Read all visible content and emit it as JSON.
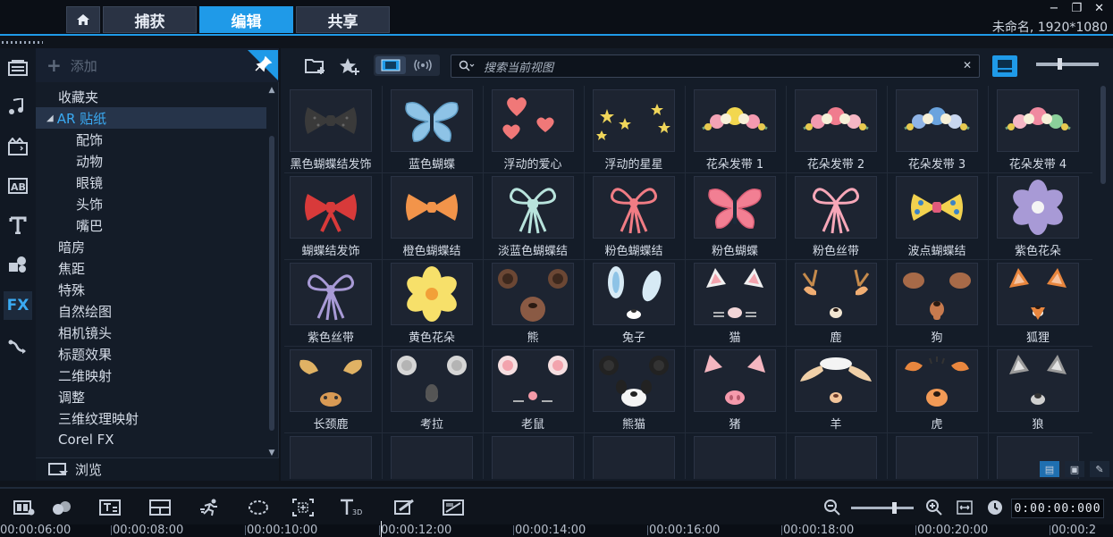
{
  "window": {
    "title": "未命名, 1920*1080",
    "controls": [
      "−",
      "❐",
      "✕"
    ]
  },
  "tabs": [
    {
      "label": "捕获",
      "active": false
    },
    {
      "label": "编辑",
      "active": true
    },
    {
      "label": "共享",
      "active": false
    }
  ],
  "icon_bar": [
    "media-icon",
    "audio-icon",
    "instant-project-icon",
    "transition-icon",
    "title-icon",
    "graphics-icon",
    "filter-fx-icon",
    "path-icon"
  ],
  "icon_bar_fx_label": "FX",
  "icon_bar_transition_label": "AB",
  "category_panel": {
    "add_label": "添加",
    "items": [
      {
        "label": "收藏夹",
        "level": 0
      },
      {
        "label": "AR 贴纸",
        "level": 0,
        "selected": true,
        "expanded": true,
        "arrow": "◢"
      },
      {
        "label": "配饰",
        "level": 1
      },
      {
        "label": "动物",
        "level": 1
      },
      {
        "label": "眼镜",
        "level": 1
      },
      {
        "label": "头饰",
        "level": 1
      },
      {
        "label": "嘴巴",
        "level": 1
      },
      {
        "label": "暗房",
        "level": 0
      },
      {
        "label": "焦距",
        "level": 0
      },
      {
        "label": "特殊",
        "level": 0
      },
      {
        "label": "自然绘图",
        "level": 0
      },
      {
        "label": "相机镜头",
        "level": 0
      },
      {
        "label": "标题效果",
        "level": 0
      },
      {
        "label": "二维映射",
        "level": 0
      },
      {
        "label": "调整",
        "level": 0
      },
      {
        "label": "三维纹理映射",
        "level": 0
      },
      {
        "label": "Corel FX",
        "level": 0
      }
    ],
    "browse_label": "浏览"
  },
  "library": {
    "search_placeholder": "搜索当前视图",
    "items": [
      "黑色蝴蝶结发饰",
      "蓝色蝴蝶",
      "浮动的爱心",
      "浮动的星星",
      "花朵发带 1",
      "花朵发带 2",
      "花朵发带 3",
      "花朵发带 4",
      "蝴蝶结发饰",
      "橙色蝴蝶结",
      "淡蓝色蝴蝶结",
      "粉色蝴蝶结",
      "粉色蝴蝶",
      "粉色丝带",
      "波点蝴蝶结",
      "紫色花朵",
      "紫色丝带",
      "黄色花朵",
      "熊",
      "兔子",
      "猫",
      "鹿",
      "狗",
      "狐狸",
      "长颈鹿",
      "考拉",
      "老鼠",
      "熊猫",
      "猪",
      "羊",
      "虎",
      "狼",
      "",
      "",
      "",
      "",
      "",
      "",
      "",
      ""
    ]
  },
  "timeline": {
    "timecode": "0:00:00:000",
    "ruler": [
      "00:00:06:00",
      "00:00:08:00",
      "00:00:10:00",
      "00:00:12:00",
      "00:00:14:00",
      "00:00:16:00",
      "00:00:18:00",
      "00:00:20:00",
      "00:00:2"
    ]
  },
  "colors": {
    "accent": "#1f9ae8",
    "background": "#141c28",
    "selected_text": "#3aaaf2"
  }
}
